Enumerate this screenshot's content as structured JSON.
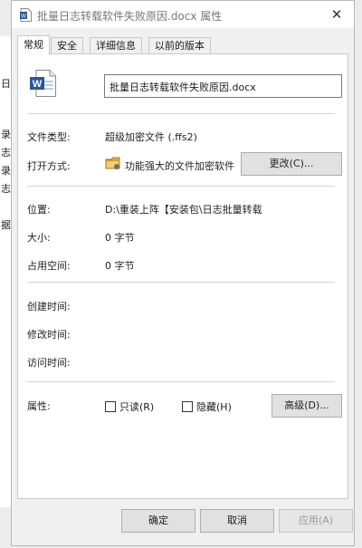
{
  "window": {
    "title": "批量日志转载软件失败原因.docx 属性",
    "close_glyph": "✕"
  },
  "tabs": [
    {
      "label": "常规",
      "active": true
    },
    {
      "label": "安全",
      "active": false
    },
    {
      "label": "详细信息",
      "active": false
    },
    {
      "label": "以前的版本",
      "active": false
    }
  ],
  "general": {
    "filename": "批量日志转载软件失败原因.docx",
    "file_type_label": "文件类型:",
    "file_type_value": "超级加密文件 (.ffs2)",
    "open_with_label": "打开方式:",
    "open_with_value": "功能强大的文件加密软件",
    "change_button": "更改(C)...",
    "location_label": "位置:",
    "location_value": "D:\\重装上阵【安装包\\日志批量转载",
    "size_label": "大小:",
    "size_value": "0 字节",
    "size_on_disk_label": "占用空间:",
    "size_on_disk_value": "0 字节",
    "created_label": "创建时间:",
    "modified_label": "修改时间:",
    "accessed_label": "访问时间:",
    "attributes_label": "属性:",
    "readonly_label": "只读(R)",
    "hidden_label": "隐藏(H)",
    "advanced_button": "高级(D)..."
  },
  "footer": {
    "ok": "确定",
    "cancel": "取消",
    "apply": "应用(A)"
  },
  "background_glyphs": [
    "日",
    "录",
    "志",
    "录",
    "志",
    "据"
  ],
  "colors": {
    "word_blue": "#2b5797",
    "folder_yellow": "#e8b84a"
  }
}
